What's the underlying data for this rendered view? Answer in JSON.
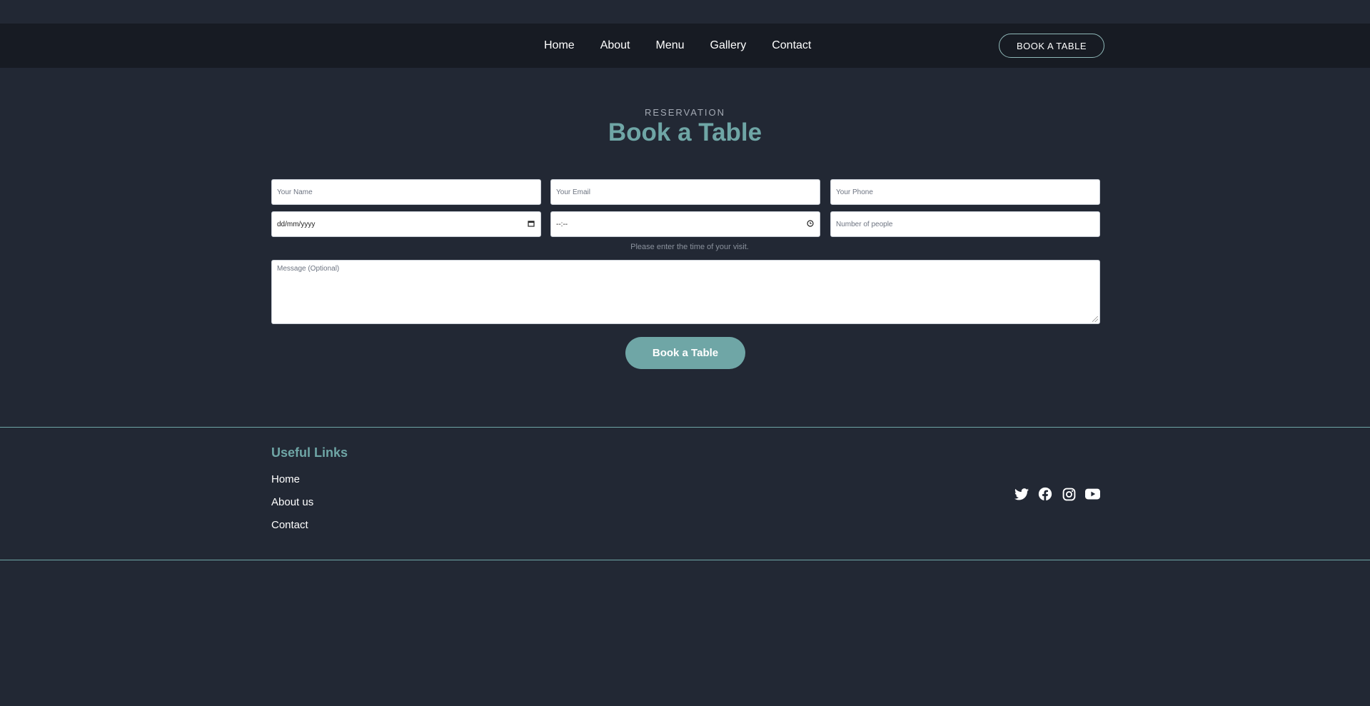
{
  "nav": {
    "links": [
      "Home",
      "About",
      "Menu",
      "Gallery",
      "Contact"
    ],
    "cta_label": "BOOK A TABLE"
  },
  "section": {
    "subtitle": "RESERVATION",
    "title": "Book a Table"
  },
  "form": {
    "name_placeholder": "Your Name",
    "email_placeholder": "Your Email",
    "phone_placeholder": "Your Phone",
    "date_value": "dd/mm/yyyy",
    "time_value": "--:--",
    "people_placeholder": "Number of people",
    "time_hint": "Please enter the time of your visit.",
    "message_placeholder": "Message (Optional)",
    "submit_label": "Book a Table"
  },
  "footer": {
    "title": "Useful Links",
    "links": [
      "Home",
      "About us",
      "Contact"
    ],
    "socials": [
      "twitter-icon",
      "facebook-icon",
      "instagram-icon",
      "youtube-icon"
    ]
  },
  "colors": {
    "accent": "#6fa6a6",
    "background": "#222834",
    "navbar": "#171b23"
  }
}
